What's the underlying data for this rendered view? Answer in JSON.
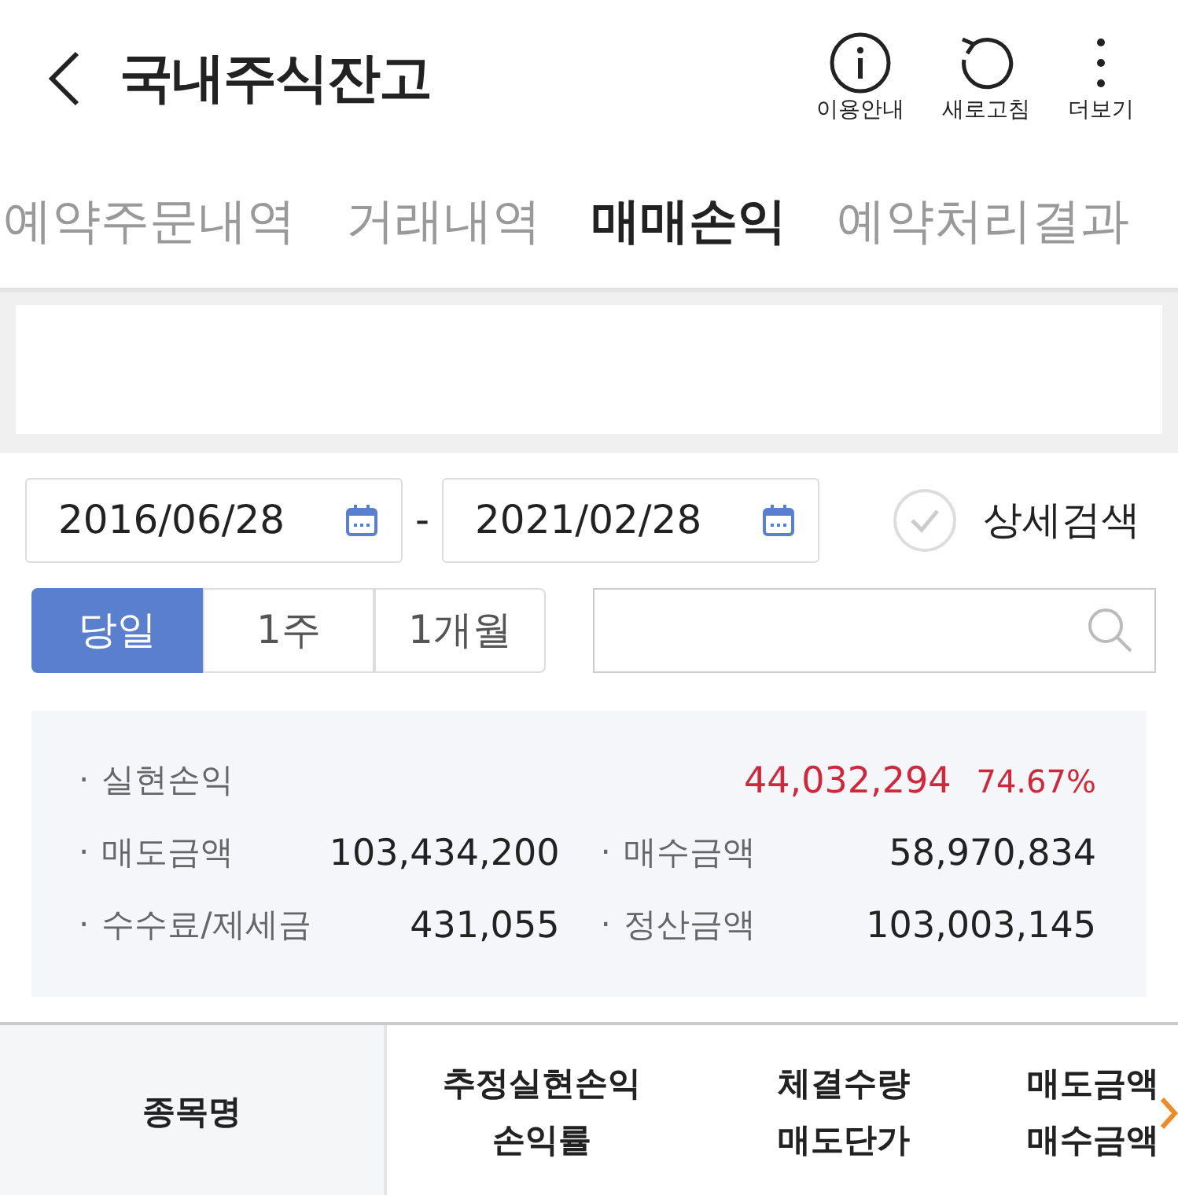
{
  "header": {
    "title": "국내주식잔고",
    "actions": [
      {
        "kind": "info",
        "label": "이용안내"
      },
      {
        "kind": "refresh",
        "label": "새로고침"
      },
      {
        "kind": "more",
        "label": "더보기"
      }
    ]
  },
  "tabs": [
    {
      "label": "예약주문내역",
      "selected": false
    },
    {
      "label": "거래내역",
      "selected": false
    },
    {
      "label": "매매손익",
      "selected": true
    },
    {
      "label": "예약처리결과",
      "selected": false
    }
  ],
  "date_range": {
    "from": "2016/06/28",
    "separator": "-",
    "to": "2021/02/28"
  },
  "detail_search": {
    "label": "상세검색",
    "checked": false
  },
  "periods": [
    {
      "label": "당일",
      "selected": true
    },
    {
      "label": "1주",
      "selected": false
    },
    {
      "label": "1개월",
      "selected": false
    }
  ],
  "summary": {
    "bullet": "·",
    "realized": {
      "label": "실현손익",
      "amount": "44,032,294",
      "rate": "74.67%"
    },
    "items": [
      {
        "label": "매도금액",
        "value": "103,434,200"
      },
      {
        "label": "매수금액",
        "value": "58,970,834"
      },
      {
        "label": "수수료/제세금",
        "value": "431,055"
      },
      {
        "label": "정산금액",
        "value": "103,003,145"
      }
    ]
  },
  "table": {
    "columns": [
      {
        "lines": [
          "종목명"
        ]
      },
      {
        "lines": [
          "추정실현손익",
          "손익률"
        ]
      },
      {
        "lines": [
          "체결수량",
          "매도단가"
        ]
      },
      {
        "lines": [
          "매도금액",
          "매수금액"
        ]
      }
    ]
  }
}
